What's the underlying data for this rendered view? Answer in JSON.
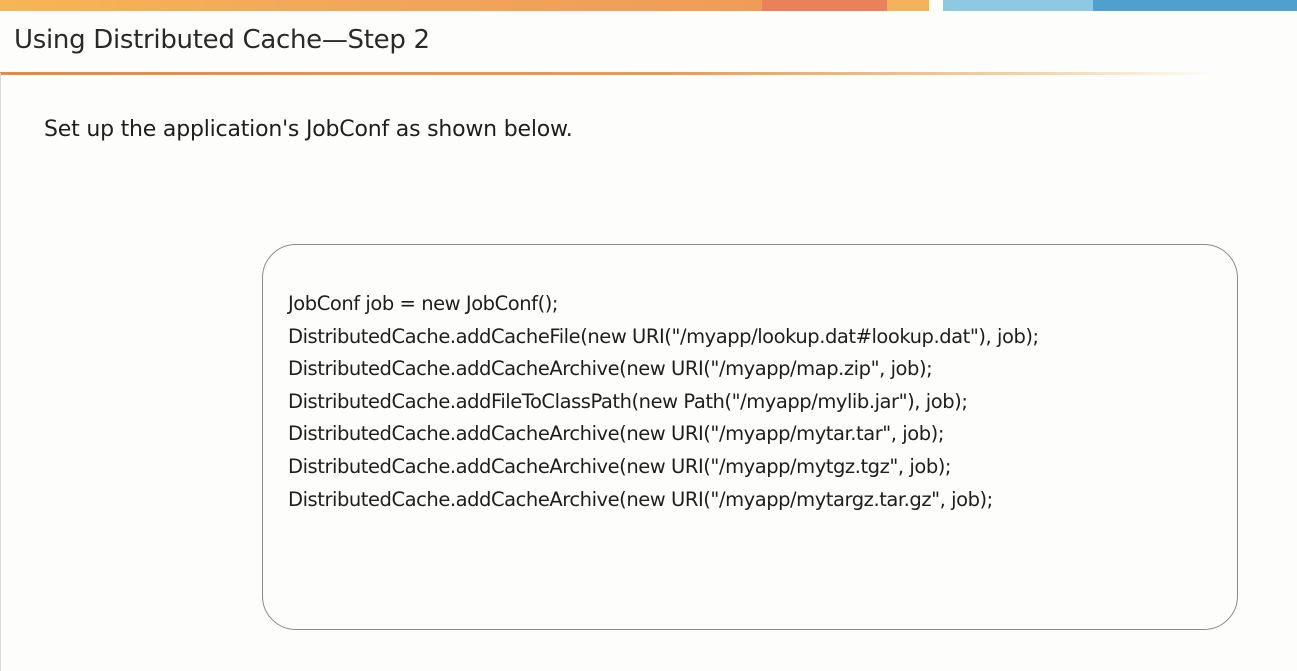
{
  "slide": {
    "title": "Using Distributed Cache—Step 2",
    "subtitle": "Set up the application's JobConf as shown below.",
    "code_lines": [
      "JobConf job = new JobConf();",
      "DistributedCache.addCacheFile(new URI(\"/myapp/lookup.dat#lookup.dat\"), job);",
      "DistributedCache.addCacheArchive(new URI(\"/myapp/map.zip\", job);",
      "DistributedCache.addFileToClassPath(new Path(\"/myapp/mylib.jar\"), job);",
      "DistributedCache.addCacheArchive(new URI(\"/myapp/mytar.tar\", job);",
      "DistributedCache.addCacheArchive(new URI(\"/myapp/mytgz.tgz\", job);",
      "DistributedCache.addCacheArchive(new URI(\"/myapp/mytargz.tar.gz\", job);"
    ]
  },
  "colors": {
    "accent_orange": "#ef9c58",
    "accent_red_orange": "#e8825a",
    "accent_light_blue": "#8ec9e3",
    "accent_blue": "#4f9fcf",
    "text": "#1e1e1e",
    "box_border": "#8a8a8a"
  }
}
